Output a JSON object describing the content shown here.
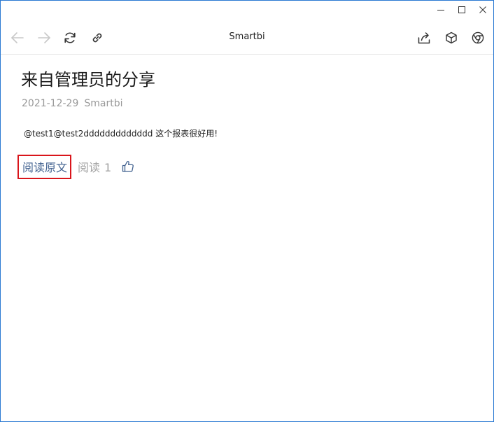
{
  "window": {
    "controls": [
      "minimize",
      "maximize",
      "close"
    ]
  },
  "toolbar": {
    "title": "Smartbi",
    "icons": {
      "back": "arrow-left-icon",
      "forward": "arrow-right-icon",
      "refresh": "refresh-icon",
      "link": "link-icon",
      "share": "share-icon",
      "cube": "cube-icon",
      "browser": "chrome-icon"
    }
  },
  "article": {
    "title": "来自管理员的分享",
    "date": "2021-12-29",
    "author": "Smartbi",
    "body": "@test1@test2ddddddddddddd  这个报表很好用!",
    "read_original_label": "阅读原文",
    "read_label": "阅读",
    "read_count": "1"
  },
  "colors": {
    "window_border": "#2b79d2",
    "link": "#41618f",
    "highlight_border": "#d9151b",
    "muted": "#999999"
  }
}
